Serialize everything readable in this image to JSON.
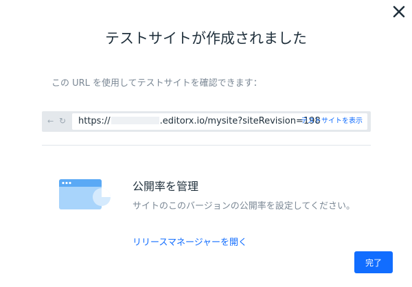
{
  "dialog": {
    "title": "テストサイトが作成されました",
    "description": "この URL を使用してテストサイトを確認できます：",
    "close_icon": "close-icon"
  },
  "browser": {
    "back_icon": "←",
    "refresh_icon": "↻",
    "url_prefix": "https://",
    "url_suffix": ".editorx.io/mysite?siteRevision=198",
    "view_link": "テストサイトを表示"
  },
  "section": {
    "illustration_icon": "browser-pie-chart-icon",
    "title": "公開率を管理",
    "description": "サイトのこのバージョンの公開率を設定してください。",
    "link": "リリースマネージャーを開く"
  },
  "footer": {
    "done_label": "完了"
  },
  "colors": {
    "accent": "#116dff",
    "text_dark": "#20303c",
    "text_muted": "#7a8794",
    "illustration_light": "#a8d4fb",
    "illustration_dark": "#5aa9f5"
  }
}
